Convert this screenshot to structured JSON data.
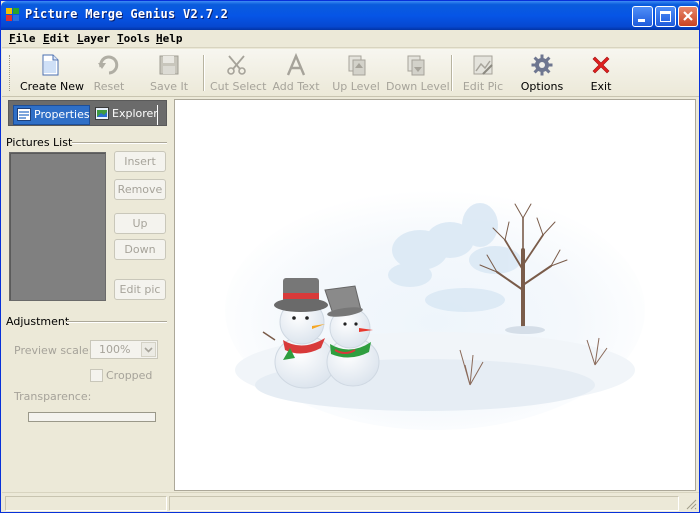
{
  "window": {
    "title": "Picture Merge Genius V2.7.2"
  },
  "menu": [
    "File",
    "Edit",
    "Layer",
    "Tools",
    "Help"
  ],
  "toolbar": {
    "create_new": "Create New",
    "reset": "Reset",
    "save_it": "Save It",
    "cut_select": "Cut Select",
    "add_text": "Add Text",
    "up_level": "Up Level",
    "down_level": "Down Level",
    "edit_pic": "Edit Pic",
    "options": "Options",
    "exit": "Exit"
  },
  "tabs": {
    "properties": "Properties",
    "explorer": "Explorer"
  },
  "pictures_list": {
    "title": "Pictures List",
    "insert": "Insert",
    "remove": "Remove",
    "up": "Up",
    "down": "Down",
    "edit_pic": "Edit pic"
  },
  "adjustment": {
    "title": "Adjustment",
    "preview_scale_label": "Preview scale:",
    "preview_scale_value": "100%",
    "cropped_label": "Cropped",
    "transparence_label": "Transparence:"
  },
  "colors": {
    "titlebar": "#0655e6",
    "tab_active": "#2f6fc7",
    "exit_icon": "#e02020",
    "disabled_text": "#a6a39a"
  }
}
